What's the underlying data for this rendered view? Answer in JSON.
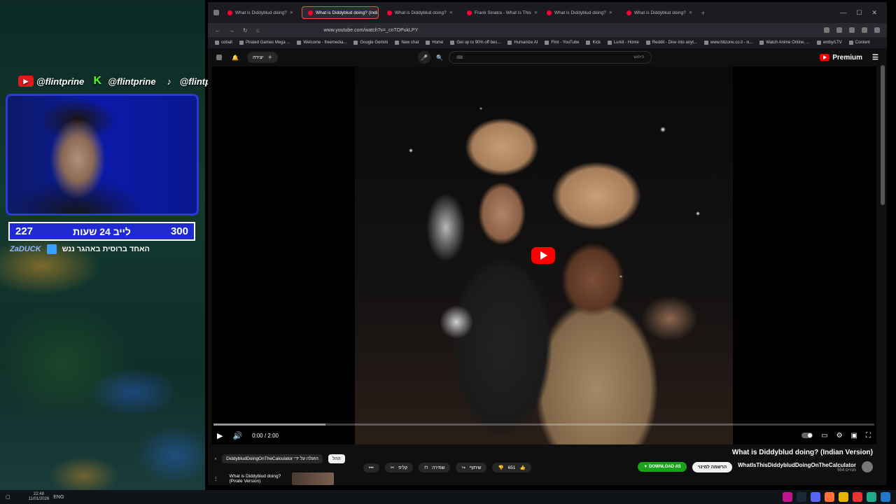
{
  "overlay": {
    "socials": [
      {
        "icon": "youtube-icon",
        "handle": "@flintprine"
      },
      {
        "icon": "kick-icon",
        "handle": "@flintprine"
      },
      {
        "icon": "tiktok-icon",
        "handle": "@flintprine"
      }
    ],
    "stats": {
      "left": "227",
      "middle": "לייב 24 שעות",
      "right": "300"
    },
    "ticker": {
      "name": "ZaDUCK",
      "message": "האחד ברוסית באהגר ננש"
    }
  },
  "browser": {
    "tabs": [
      {
        "title": "What is Diddyblud doing?",
        "active": false
      },
      {
        "title": "What is Diddyblud doing? (Indi",
        "active": true
      },
      {
        "title": "What is Diddyblud doing?",
        "active": false
      },
      {
        "title": "Frank Sinatra - What Is This",
        "active": false
      },
      {
        "title": "What is Diddyblud doing?",
        "active": false
      },
      {
        "title": "What is Diddyblud doing?",
        "active": false
      }
    ],
    "url": "www.youtube.com/watch?v=_cnTOPukLPY",
    "bookmarks": [
      "cobalt",
      "Pirated Games Mega ...",
      "Welcome - freemedia...",
      "Google Gemini",
      "New chat",
      "Home",
      "Get up to 90% off bes...",
      "Humanize AI",
      "Flint - YouTube",
      "Kick",
      "Lurkit - Home",
      "Reddit - Dive into anyt...",
      "www.hitzone.co.il - מ...",
      "Watch Anime Online, ...",
      "emby/LTV",
      "Content"
    ]
  },
  "youtube": {
    "create_label": "יצירה",
    "search_placeholder": "חיפוש",
    "logo_label": "Premium",
    "player": {
      "time": "0:00 / 2:00",
      "progress": 0,
      "buffered": 0.17
    },
    "video_title": "What is Diddyblud doing? (Indian Version)",
    "channel_name": "WhatIsThisDiddybludDoingOnTheCalculator",
    "subs": "554 מנויים",
    "subscribe_label": "הרשמה למינוי",
    "download_label": "▼ DOWNLOAD AS",
    "actions": {
      "likes": "651",
      "share": "שיתוף",
      "save": "שמירה",
      "clip": "קליפ",
      "more": "•••"
    },
    "playlist": {
      "label": "ההל",
      "uploader": "DiddybludDoingOnTheCalculator הועלה על ידי"
    },
    "next": {
      "title": "What is Diddyblud doing?",
      "subtitle": "(Pirate Version)"
    }
  },
  "taskbar": {
    "time": "22:48",
    "date": "11/01/2026",
    "lang": "ENG"
  }
}
